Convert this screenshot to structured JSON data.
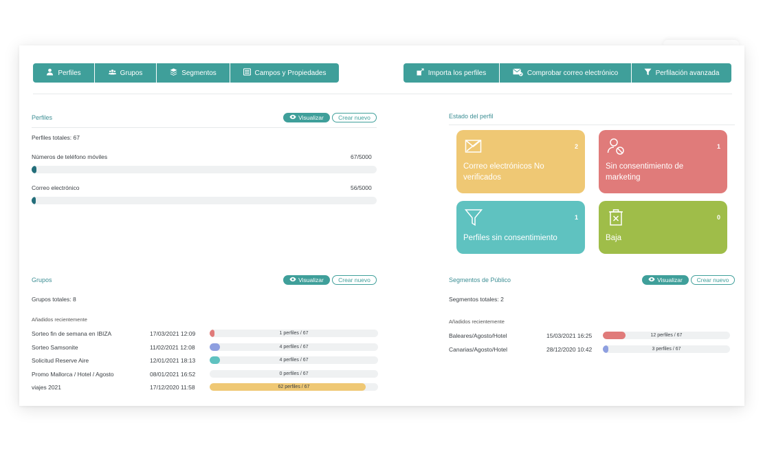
{
  "toolbar": {
    "left": [
      {
        "label": "Perfiles",
        "icon": "user-icon"
      },
      {
        "label": "Grupos",
        "icon": "users-icon"
      },
      {
        "label": "Segmentos",
        "icon": "layers-icon"
      },
      {
        "label": "Campos y Propiedades",
        "icon": "list-icon"
      }
    ],
    "right": [
      {
        "label": "Importa los perfiles",
        "icon": "import-icon"
      },
      {
        "label": "Comprobar correo electrónico",
        "icon": "mail-check-icon"
      },
      {
        "label": "Perfilación avanzada",
        "icon": "filter-icon"
      }
    ]
  },
  "actions": {
    "view": "Visualizar",
    "create": "Crear nuevo"
  },
  "perfiles": {
    "title": "Perfiles",
    "total": "Perfiles totales: 67",
    "phone_label": "Números de teléfono móviles",
    "phone_value": "67/5000",
    "phone_fraction": 0.0134,
    "email_label": "Correo electrónico",
    "email_value": "56/5000",
    "email_fraction": 0.0112
  },
  "estado": {
    "title": "Estado del perfil",
    "tiles": [
      {
        "label": "Correo electrónicos No verificados",
        "count": "2",
        "color": "#efc874",
        "icon": "mail-x-icon"
      },
      {
        "label": "Sin consentimiento de marketing",
        "count": "1",
        "color": "#e07b7a",
        "icon": "user-blocked-icon"
      },
      {
        "label": "Perfiles sin consentimiento",
        "count": "1",
        "color": "#5fc2c0",
        "icon": "funnel-icon"
      },
      {
        "label": "Baja",
        "count": "0",
        "color": "#9fbd49",
        "icon": "trash-icon"
      }
    ]
  },
  "grupos": {
    "title": "Grupos",
    "total": "Grupos totales: 8",
    "recent_label": "Añadidos recientemente",
    "rows": [
      {
        "name": "Sorteo fin de semana en IBIZA",
        "date": "17/03/2021 12:09",
        "bar": "1 perfiles / 67",
        "fraction": 0.015,
        "color": "#e07b7a"
      },
      {
        "name": "Sorteo Samsonite",
        "date": "11/02/2021 12:08",
        "bar": "4 perfiles / 67",
        "fraction": 0.06,
        "color": "#8e9fe0"
      },
      {
        "name": "Solicitud Reserve Aire",
        "date": "12/01/2021 18:13",
        "bar": "4 perfiles / 67",
        "fraction": 0.06,
        "color": "#5fc2c0"
      },
      {
        "name": "Promo Mallorca / Hotel / Agosto",
        "date": "08/01/2021 16:52",
        "bar": "0 perfiles / 67",
        "fraction": 0,
        "color": "#cccccc"
      },
      {
        "name": "viajes 2021",
        "date": "17/12/2020 11:58",
        "bar": "62 perfiles / 67",
        "fraction": 0.925,
        "color": "#efc874"
      }
    ]
  },
  "segmentos": {
    "title": "Segmentos de Público",
    "total": "Segmentos totales: 2",
    "recent_label": "Añadidos recientemente",
    "rows": [
      {
        "name": "Baleares/Agosto/Hotel",
        "date": "15/03/2021 16:25",
        "bar": "12 perfiles / 67",
        "fraction": 0.18,
        "color": "#e07b7a"
      },
      {
        "name": "Canarias/Agosto/Hotel",
        "date": "28/12/2020 10:42",
        "bar": "3 perfiles / 67",
        "fraction": 0.045,
        "color": "#8e9fe0"
      }
    ]
  }
}
